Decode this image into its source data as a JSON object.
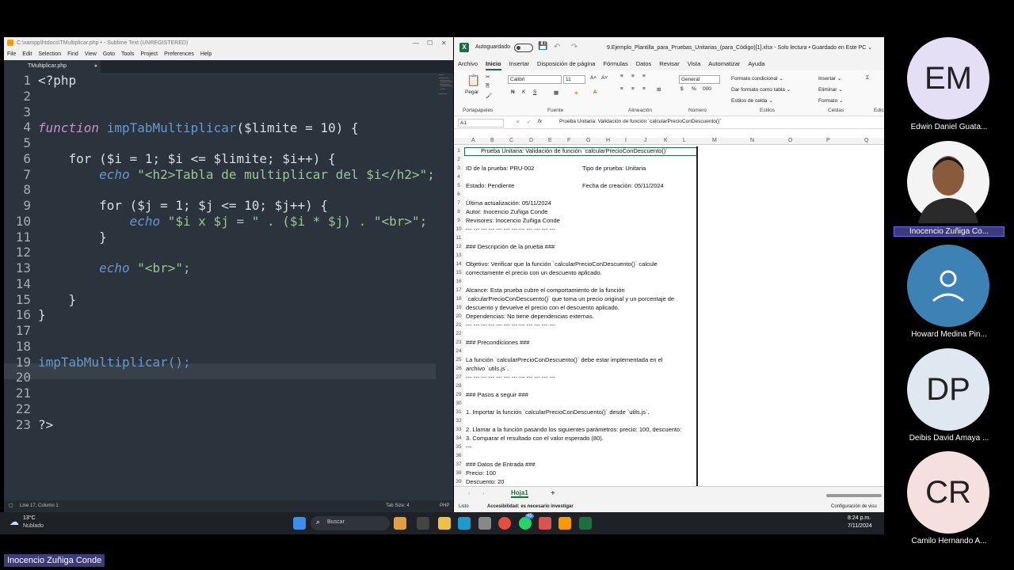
{
  "sublime": {
    "title": "C:\\xampp\\htdocs\\TMultiplicar.php • - Sublime Text (UNREGISTERED)",
    "menu": [
      "File",
      "Edit",
      "Selection",
      "Find",
      "View",
      "Goto",
      "Tools",
      "Project",
      "Preferences",
      "Help"
    ],
    "tab": "TMultiplicar.php",
    "line_numbers": [
      "1",
      "2",
      "3",
      "4",
      "5",
      "6",
      "7",
      "8",
      "9",
      "10",
      "11",
      "12",
      "13",
      "14",
      "15",
      "16",
      "17",
      "18",
      "19",
      "20",
      "21",
      "22",
      "23"
    ],
    "code": {
      "l1": "<?php",
      "l4a": "function",
      "l4b": "impTabMultiplicar",
      "l4c": "($limite = 10) {",
      "l6": "    for ($i = 1; $i <= $limite; $i++) {",
      "l7a": "echo",
      "l7b": " \"<h2>Tabla de multiplicar del $i</h2>\";",
      "l9": "        for ($j = 1; $j <= 10; $j++) {",
      "l10a": "echo",
      "l10b": " \"$i x $j = \" . ($i * $j) . \"<br>\";",
      "l11": "        }",
      "l13a": "echo",
      "l13b": " \"<br>\";",
      "l15": "    }",
      "l16": "}",
      "l19": "impTabMultiplicar();",
      "l23": "?>"
    },
    "status_left": "Line 17, Column 1",
    "status_tab": "Tab Size: 4",
    "status_lang": "PHP"
  },
  "excel": {
    "autosave": "Autoguardado",
    "filename": "9.Ejemplo_Plantilla_para_Pruebas_Unitarias_(para_Código)[1].xlsx  -  Solo lectura  •  Guardado en Este PC ⌄",
    "menu": [
      "Archivo",
      "Inicio",
      "Insertar",
      "Disposición de página",
      "Fórmulas",
      "Datos",
      "Revisar",
      "Vista",
      "Automatizar",
      "Ayuda"
    ],
    "ribbon": {
      "paste": "Pegar",
      "font": "Calibri",
      "size": "11",
      "number": "General",
      "cond": "Formato condicional ⌄",
      "table": "Dar formato como tabla ⌄",
      "styles_cell": "Estilos de celda ⌄",
      "insert": "Insertar ⌄",
      "delete": "Eliminar ⌄",
      "format": "Formato ⌄",
      "groups": [
        "Portapapeles",
        "Fuente",
        "Alineación",
        "Número",
        "Estilos",
        "Celdas",
        "Edic"
      ]
    },
    "namebox": "A1",
    "formula": "Prueba Unitaria: Validación de función `calcularPrecioConDescuento()`",
    "columns": [
      "A",
      "B",
      "C",
      "D",
      "E",
      "F",
      "G",
      "H",
      "I",
      "J",
      "K",
      "L",
      "M",
      "N",
      "O",
      "P",
      "Q"
    ],
    "rows": [
      {
        "n": "1",
        "t": "Prueba Unitaria: Validación de función `calcularPrecioConDescuento()`"
      },
      {
        "n": "2",
        "t": ""
      },
      {
        "n": "3",
        "t": "ID de la prueba: PRU-002",
        "t2": "Tipo de prueba: Unitaria"
      },
      {
        "n": "4",
        "t": ""
      },
      {
        "n": "5",
        "t": "Estado: Pendiente",
        "t2": "Fecha de creación: 05/11/2024"
      },
      {
        "n": "6",
        "t": ""
      },
      {
        "n": "7",
        "t": "Última actualización: 05/11/2024"
      },
      {
        "n": "8",
        "t": "Autor: Inocencio Zuñiga Conde"
      },
      {
        "n": "9",
        "t": "Revisores: Inocencio Zuñiga Conde"
      },
      {
        "n": "10",
        "t": "---   ---   ---   ---   ---   ---   ---   ---   ---   ---   ---   ---"
      },
      {
        "n": "11",
        "t": ""
      },
      {
        "n": "12",
        "t": "### Descripción de la prueba ###"
      },
      {
        "n": "13",
        "t": ""
      },
      {
        "n": "14",
        "t": "Objetivo: Verificar que la función `calcularPrecioConDescuento()` calcule"
      },
      {
        "n": "15",
        "t": "correctamente el precio con un descuento aplicado."
      },
      {
        "n": "16",
        "t": ""
      },
      {
        "n": "17",
        "t": "Alcance: Esta prueba cubre el comportamiento de la función"
      },
      {
        "n": "18",
        "t": "`calcularPrecioConDescuento()` que toma un precio original y un porcentaje de"
      },
      {
        "n": "19",
        "t": "descuento y devuelve el precio con el descuento aplicado."
      },
      {
        "n": "20",
        "t": "Dependencias: No tiene dependencias externas."
      },
      {
        "n": "21",
        "t": "---   ---   ---   ---   ---   ---   ---   ---   ---   ---   ---   ---"
      },
      {
        "n": "22",
        "t": ""
      },
      {
        "n": "23",
        "t": "### Precondiciones ###"
      },
      {
        "n": "24",
        "t": ""
      },
      {
        "n": "25",
        "t": "La función `calcularPrecioConDescuento()` debe estar implementada en el"
      },
      {
        "n": "26",
        "t": "archivo `utils.js`."
      },
      {
        "n": "27",
        "t": "---   ---   ---   ---   ---   ---   ---   ---   ---   ---   ---   ---"
      },
      {
        "n": "28",
        "t": ""
      },
      {
        "n": "29",
        "t": "### Pasos a seguir ###"
      },
      {
        "n": "30",
        "t": ""
      },
      {
        "n": "31",
        "t": "1. Importar la función `calcularPrecioConDescuento()` desde `utils.js`."
      },
      {
        "n": "32",
        "t": ""
      },
      {
        "n": "33",
        "t": "2. Llamar a la función pasando los siguientes parámetros: precio: 100, descuento:"
      },
      {
        "n": "34",
        "t": "3. Comparar el resultado con el valor esperado (80)."
      },
      {
        "n": "35",
        "t": "---"
      },
      {
        "n": "36",
        "t": ""
      },
      {
        "n": "37",
        "t": "### Datos de Entrada ###"
      },
      {
        "n": "38",
        "t": "Precio: 100"
      },
      {
        "n": "39",
        "t": "Descuento: 20"
      }
    ],
    "sheet_tab": "Hoja1",
    "status_ready": "Listo",
    "status_access": "Accesibilidad: es necesario investigar",
    "status_right": "Configuración de visu"
  },
  "taskbar": {
    "weather_temp": "13°C",
    "weather_desc": "Nublado",
    "search": "Buscar",
    "time": "8:24 p.m.",
    "date": "7/11/2024",
    "badge": "45"
  },
  "participants": [
    {
      "initials": "EM",
      "name": "Edwin Daniel Guata...",
      "color": "#e4dff5"
    },
    {
      "initials": "",
      "name": "Inocencio Zuñiga Co...",
      "color": "#ffffff"
    },
    {
      "initials": "",
      "name": "Howard Medina Pin...",
      "color": "#3d82b5"
    },
    {
      "initials": "DP",
      "name": "Deibis David Amaya ...",
      "color": "#dfe8f0"
    },
    {
      "initials": "CR",
      "name": "Camilo Hernando A...",
      "color": "#f6e0df"
    }
  ],
  "speaker_tag": "Inocencio Zuñiga Conde"
}
